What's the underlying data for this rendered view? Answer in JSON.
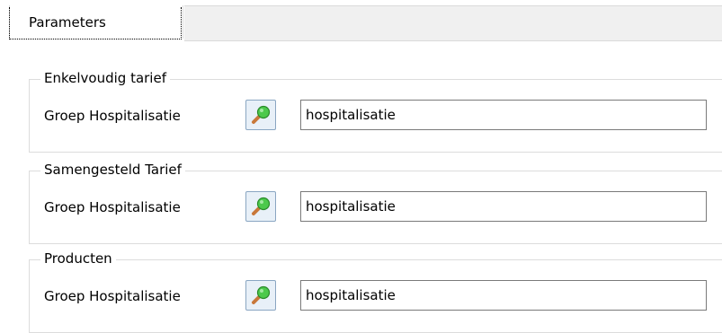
{
  "tabs": [
    {
      "label": "Parameters",
      "active": true
    }
  ],
  "groups": [
    {
      "title": "Enkelvoudig tarief",
      "field_label": "Groep Hospitalisatie",
      "button_icon": "search-icon",
      "value": "hospitalisatie"
    },
    {
      "title": "Samengesteld Tarief",
      "field_label": "Groep Hospitalisatie",
      "button_icon": "search-icon",
      "value": "hospitalisatie"
    },
    {
      "title": "Producten",
      "field_label": "Groep Hospitalisatie",
      "button_icon": "search-icon",
      "value": "hospitalisatie"
    }
  ],
  "colors": {
    "search_icon_lens": "#4cc94c",
    "search_icon_handle": "#c8783a"
  }
}
